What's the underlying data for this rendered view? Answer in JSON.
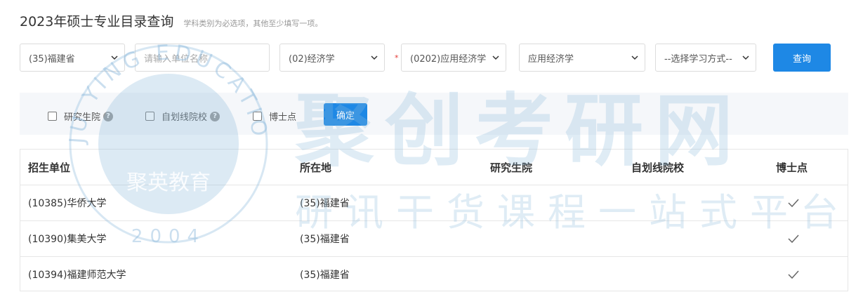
{
  "header": {
    "title": "2023年硕士专业目录查询",
    "hint": "学科类别为必选项，其他至少填写一项。"
  },
  "filters": {
    "province": "(35)福建省",
    "unit_placeholder": "请输入单位名称",
    "category": "(02)经济学",
    "required_mark": "*",
    "major": "(0202)应用经济学",
    "sub_major": "应用经济学",
    "study_mode": "--选择学习方式--",
    "query_label": "查询"
  },
  "options": {
    "graduate_school": "研究生院",
    "self_line": "自划线院校",
    "doctoral": "博士点",
    "help": "?",
    "confirm_label": "确定"
  },
  "table": {
    "headers": [
      "招生单位",
      "所在地",
      "研究生院",
      "自划线院校",
      "博士点"
    ],
    "rows": [
      {
        "unit": "(10385)华侨大学",
        "location": "(35)福建省",
        "graduate_school": false,
        "self_line": false,
        "doctoral": true
      },
      {
        "unit": "(10390)集美大学",
        "location": "(35)福建省",
        "graduate_school": false,
        "self_line": false,
        "doctoral": true
      },
      {
        "unit": "(10394)福建师范大学",
        "location": "(35)福建省",
        "graduate_school": false,
        "self_line": false,
        "doctoral": true
      }
    ]
  },
  "watermark": {
    "main": "聚创考研网",
    "sub": "研讯干货课程一站式平台",
    "logo_name": "聚英教育",
    "logo_arc": "JU YING EDUCATION",
    "logo_year": "2004",
    "color": "#8cb9dc"
  },
  "colors": {
    "accent": "#1e88e5",
    "required": "#e53935"
  }
}
